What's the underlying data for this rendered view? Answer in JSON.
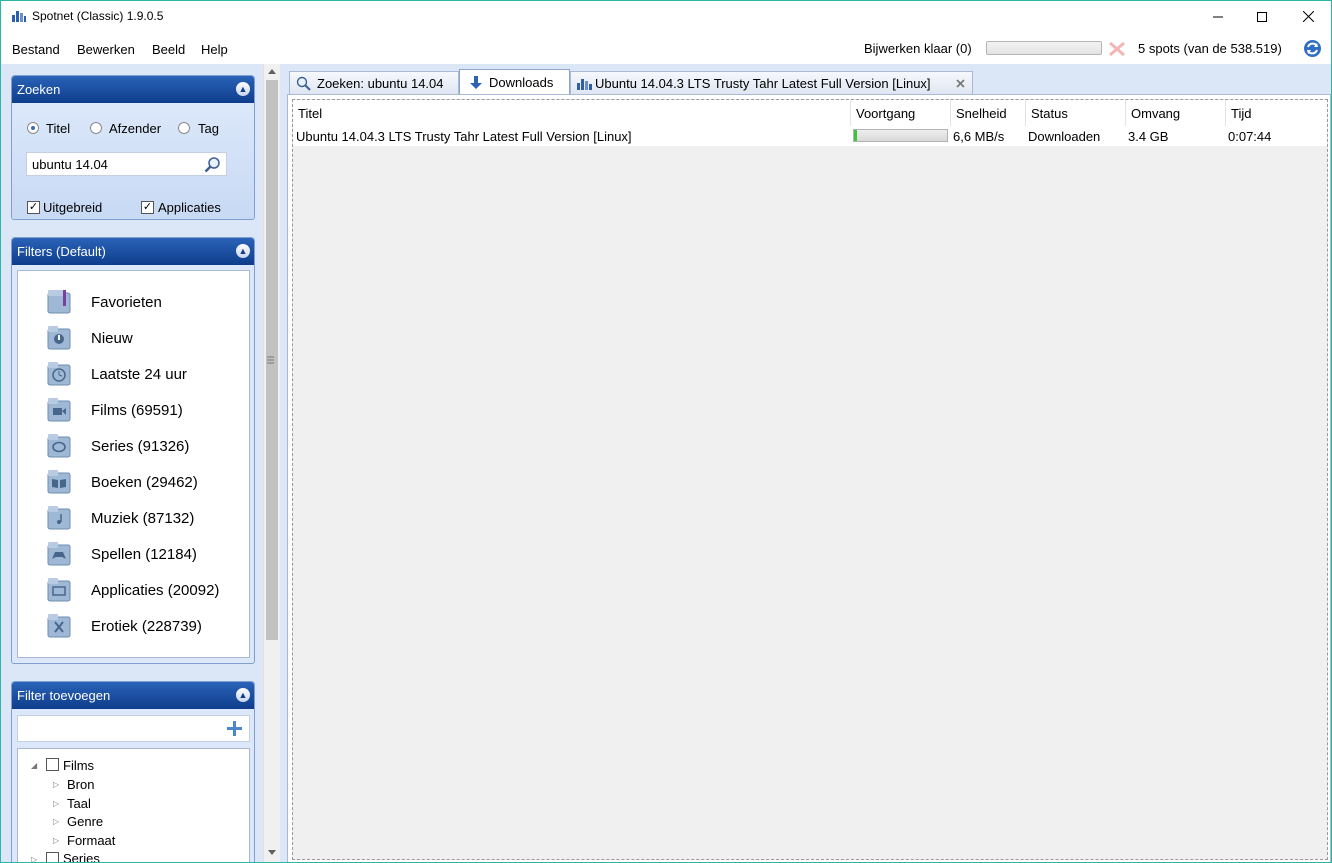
{
  "window": {
    "title": "Spotnet (Classic) 1.9.0.5"
  },
  "menu": {
    "items": [
      "Bestand",
      "Bewerken",
      "Beeld",
      "Help"
    ]
  },
  "statusbar": {
    "update_status": "Bijwerken klaar (0)",
    "update_progress": 0,
    "spots_count": "5 spots (van de 538.519)"
  },
  "zoeken": {
    "header": "Zoeken",
    "radios": [
      "Titel",
      "Afzender",
      "Tag"
    ],
    "selected_radio": "Titel",
    "query": "ubuntu 14.04",
    "checks": [
      {
        "label": "Uitgebreid",
        "checked": true
      },
      {
        "label": "Applicaties",
        "checked": true
      }
    ]
  },
  "filters": {
    "header": "Filters (Default)",
    "items": [
      {
        "label": "Favorieten",
        "icon": "favorites-folder-icon"
      },
      {
        "label": "Nieuw",
        "icon": "new-folder-icon"
      },
      {
        "label": "Laatste 24 uur",
        "icon": "clock-folder-icon"
      },
      {
        "label": "Films (69591)",
        "icon": "films-folder-icon"
      },
      {
        "label": "Series (91326)",
        "icon": "series-folder-icon"
      },
      {
        "label": "Boeken (29462)",
        "icon": "books-folder-icon"
      },
      {
        "label": "Muziek (87132)",
        "icon": "music-folder-icon"
      },
      {
        "label": "Spellen (12184)",
        "icon": "games-folder-icon"
      },
      {
        "label": "Applicaties (20092)",
        "icon": "apps-folder-icon"
      },
      {
        "label": "Erotiek (228739)",
        "icon": "erotic-folder-icon"
      }
    ]
  },
  "filter_add": {
    "header": "Filter toevoegen",
    "tree": [
      {
        "label": "Films",
        "children": [
          "Bron",
          "Taal",
          "Genre",
          "Formaat"
        ]
      },
      {
        "label": "Series"
      }
    ]
  },
  "tabs": [
    {
      "label": "Zoeken: ubuntu 14.04",
      "icon": "search-icon"
    },
    {
      "label": "Downloads",
      "icon": "download-arrow-icon",
      "active": true
    },
    {
      "label": "Ubuntu 14.04.3 LTS Trusty Tahr Latest Full Version [Linux]",
      "icon": "spot-icon",
      "closable": true
    }
  ],
  "downloads": {
    "columns": [
      "Titel",
      "Voortgang",
      "Snelheid",
      "Status",
      "Omvang",
      "Tijd"
    ],
    "rows": [
      {
        "title": "Ubuntu 14.04.3 LTS Trusty Tahr Latest Full Version [Linux]",
        "progress": 0.03,
        "speed": "6,6 MB/s",
        "status": "Downloaden",
        "size": "3.4 GB",
        "time": "0:07:44"
      }
    ]
  },
  "colors": {
    "accent": "#0f3d8c",
    "panel_bg": "#dbe6f6",
    "progress_green": "#3bc43b",
    "frame": "#2bb5a7"
  }
}
